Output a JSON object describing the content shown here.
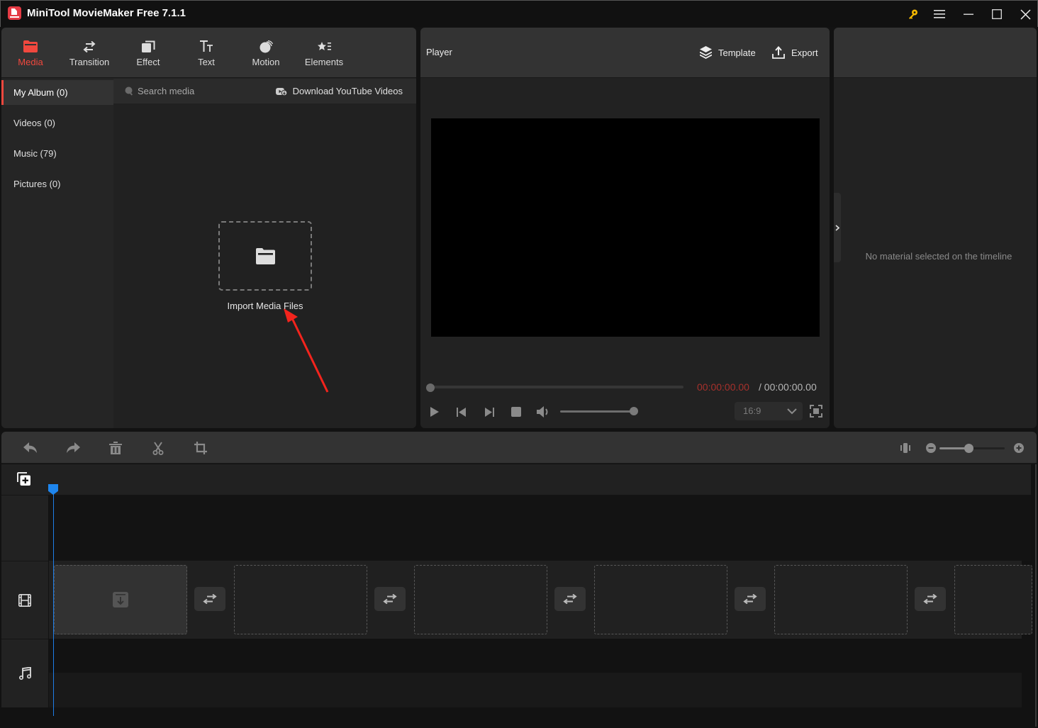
{
  "window": {
    "title": "MiniTool MovieMaker Free 7.1.1",
    "controls": [
      "key-icon",
      "menu-icon",
      "minimize-icon",
      "maximize-icon",
      "close-icon"
    ],
    "accent_color": "#f0483e",
    "key_color": "#f5b800"
  },
  "media_tabs": [
    {
      "label": "Media",
      "icon": "folder-icon",
      "active": true
    },
    {
      "label": "Transition",
      "icon": "swap-arrows-icon",
      "active": false
    },
    {
      "label": "Effect",
      "icon": "layers-icon",
      "active": false
    },
    {
      "label": "Text",
      "icon": "text-icon",
      "active": false
    },
    {
      "label": "Motion",
      "icon": "motion-icon",
      "active": false
    },
    {
      "label": "Elements",
      "icon": "elements-icon",
      "active": false
    }
  ],
  "sidebar": {
    "items": [
      {
        "label": "My Album (0)",
        "active": true
      },
      {
        "label": "Videos (0)",
        "active": false
      },
      {
        "label": "Music (79)",
        "active": false
      },
      {
        "label": "Pictures (0)",
        "active": false
      }
    ]
  },
  "media": {
    "search_placeholder": "Search media",
    "download_label": "Download YouTube Videos",
    "import_label": "Import Media Files"
  },
  "player": {
    "title": "Player",
    "template_label": "Template",
    "export_label": "Export",
    "time_current": "00:00:00.00",
    "time_total": "/ 00:00:00.00",
    "progress": 0,
    "volume": 1.0,
    "aspect_ratio": "16:9",
    "time_current_color": "#a6312c"
  },
  "properties": {
    "empty_message": "No material selected on the timeline"
  },
  "timeline": {
    "tools": [
      "undo-icon",
      "redo-icon",
      "delete-icon",
      "split-icon",
      "crop-icon"
    ],
    "zoom_level": 0.45,
    "playhead_color": "#1e86ee",
    "clip_slot_count": 6,
    "transition_count": 5
  }
}
